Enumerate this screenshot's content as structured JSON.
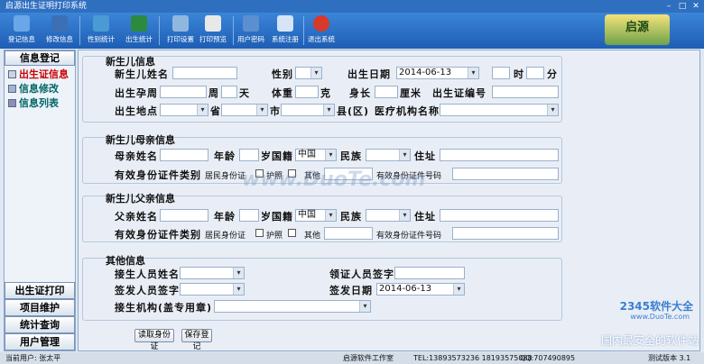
{
  "window": {
    "title": "启源出生证明打印系统"
  },
  "toolbar": {
    "buttons": [
      {
        "label": "登记信息",
        "icon": "register-icon"
      },
      {
        "label": "修改信息",
        "icon": "edit-icon"
      },
      {
        "label": "性别统计",
        "icon": "gender-stats-icon"
      },
      {
        "label": "出生统计",
        "icon": "birth-stats-icon"
      },
      {
        "label": "打印设置",
        "icon": "print-settings-icon"
      },
      {
        "label": "打印预览",
        "icon": "print-preview-icon"
      },
      {
        "label": "用户密码",
        "icon": "user-password-icon"
      },
      {
        "label": "系统注册",
        "icon": "system-register-icon"
      },
      {
        "label": "退出系统",
        "icon": "exit-icon"
      }
    ],
    "logo_text": "启源"
  },
  "sidebar": {
    "header": "信息登记",
    "items": [
      {
        "label": "出生证信息",
        "color": "#cc0000"
      },
      {
        "label": "信息修改",
        "color": "#006666"
      },
      {
        "label": "信息列表",
        "color": "#006666"
      }
    ],
    "bottom": [
      "出生证打印",
      "项目维护",
      "统计查询",
      "用户管理"
    ]
  },
  "newborn": {
    "title": "新生儿信息",
    "name_label": "新生儿姓名",
    "gender_label": "性别",
    "birth_date_label": "出生日期",
    "birth_date_value": "2014-06-13",
    "hour_label": "时",
    "minute_label": "分",
    "gest_label": "出生孕周",
    "week_label": "周",
    "day_label": "天",
    "weight_label": "体重",
    "gram_label": "克",
    "height_label": "身长",
    "cm_label": "厘米",
    "cert_no_label": "出生证编号",
    "place_label": "出生地点",
    "province_label": "省",
    "city_label": "市",
    "district_label": "县(区)",
    "institution_label": "医疗机构名称"
  },
  "mother": {
    "title": "新生儿母亲信息",
    "name_label": "母亲姓名",
    "age_label": "年龄",
    "age_unit": "岁",
    "nationality_label": "国籍",
    "nationality_value": "中国",
    "ethnic_label": "民族",
    "address_label": "住址",
    "id_type_label": "有效身份证件类别",
    "id_card": "居民身份证",
    "passport": "护照",
    "other": "其他",
    "id_no_label": "有效身份证件号码"
  },
  "father": {
    "title": "新生儿父亲信息",
    "name_label": "父亲姓名",
    "age_label": "年龄",
    "age_unit": "岁",
    "nationality_label": "国籍",
    "nationality_value": "中国",
    "ethnic_label": "民族",
    "address_label": "住址",
    "id_type_label": "有效身份证件类别",
    "id_card": "居民身份证",
    "passport": "护照",
    "other": "其他",
    "id_no_label": "有效身份证件号码"
  },
  "other_info": {
    "title": "其他信息",
    "deliverer_label": "接生人员姓名",
    "receiver_sign_label": "领证人员签字",
    "issuer_sign_label": "签发人员签字",
    "issue_date_label": "签发日期",
    "issue_date_value": "2014-06-13",
    "institution_label": "接生机构(盖专用章)"
  },
  "actions": {
    "read_id": "读取身份证",
    "save": "保存登记"
  },
  "status": {
    "user": "当前用户: 张太平",
    "studio": "启源软件工作室",
    "tel": "TEL:13893573236  18193575088",
    "qq": "QQ:707490895",
    "version": "测试版本 3.1"
  },
  "watermark": {
    "text": "www.DuoTe.com",
    "site": "2345软件大全",
    "site_url": "www.DuoTe.com",
    "slogan": "国内最安全的软件站"
  }
}
